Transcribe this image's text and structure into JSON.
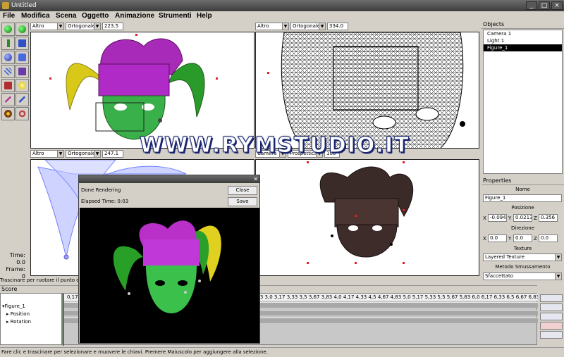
{
  "window": {
    "title": "Untitled"
  },
  "menu": [
    "File",
    "Modifica",
    "Scena",
    "Oggetto",
    "Animazione",
    "Strumenti",
    "Help"
  ],
  "viewports": {
    "top_left": {
      "view": "Altro",
      "projection": "Ortogonale",
      "value": "223.5"
    },
    "top_right": {
      "view": "Altro",
      "projection": "Ortogonale",
      "value": "334.0"
    },
    "bottom_left": {
      "view": "Altro",
      "projection": "Ortogonale",
      "value": "247.1"
    },
    "bottom_right": {
      "view": "Camera",
      "projection": "Prospettica",
      "value": "100"
    }
  },
  "time": {
    "time_label": "Time:",
    "time_value": "0.0",
    "frame_label": "Frame:",
    "frame_value": "0"
  },
  "hint": "Trascinare per ruotare il punto di vis",
  "objects": {
    "title": "Objects",
    "items": [
      "Camera 1",
      "Light 1",
      "Figure_1"
    ],
    "selected": "Figure_1"
  },
  "properties": {
    "title": "Properties",
    "name_label": "Nome",
    "name_value": "Figure_1",
    "position_label": "Posizione",
    "position": {
      "x": "-0.094",
      "y": "0.0213",
      "z": "0.356"
    },
    "direction_label": "Direzione",
    "direction": {
      "x": "0.0",
      "y": "0.0",
      "z": "0.0"
    },
    "texture_label": "Texture",
    "texture_value": "Layered Texture",
    "smoothing_label": "Metodo Smussamento",
    "smoothing_value": "Sfaccettato"
  },
  "score": {
    "title": "Score",
    "tracks": [
      "Figure_1",
      "Position",
      "Rotation"
    ],
    "ruler": "0,17 0,33 0,5 0,67 0,83 1,0 1,17 1,33 1,5 1,67 1,83 2,0 2,17 2,33 2,5 2,67 2,83 3,0 3,17 3,33 3,5 3,67 3,83 4,0 4,17 4,33 4,5 4,67 4,83 5,0 5,17 5,33 5,5 5,67 5,83 6,0 6,17 6,33 6,5 6,67 6,83"
  },
  "dialog": {
    "status": "Done Rendering",
    "elapsed": "Elapsed Time: 0:03",
    "close_label": "Close",
    "save_label": "Save"
  },
  "statusbar": "Fare clic e trascinare per selezionare e muovere le chiavi. Premere Maiuscolo per aggiungere alla selezione.",
  "watermark": "WWW.RYMSTUDIO.IT"
}
